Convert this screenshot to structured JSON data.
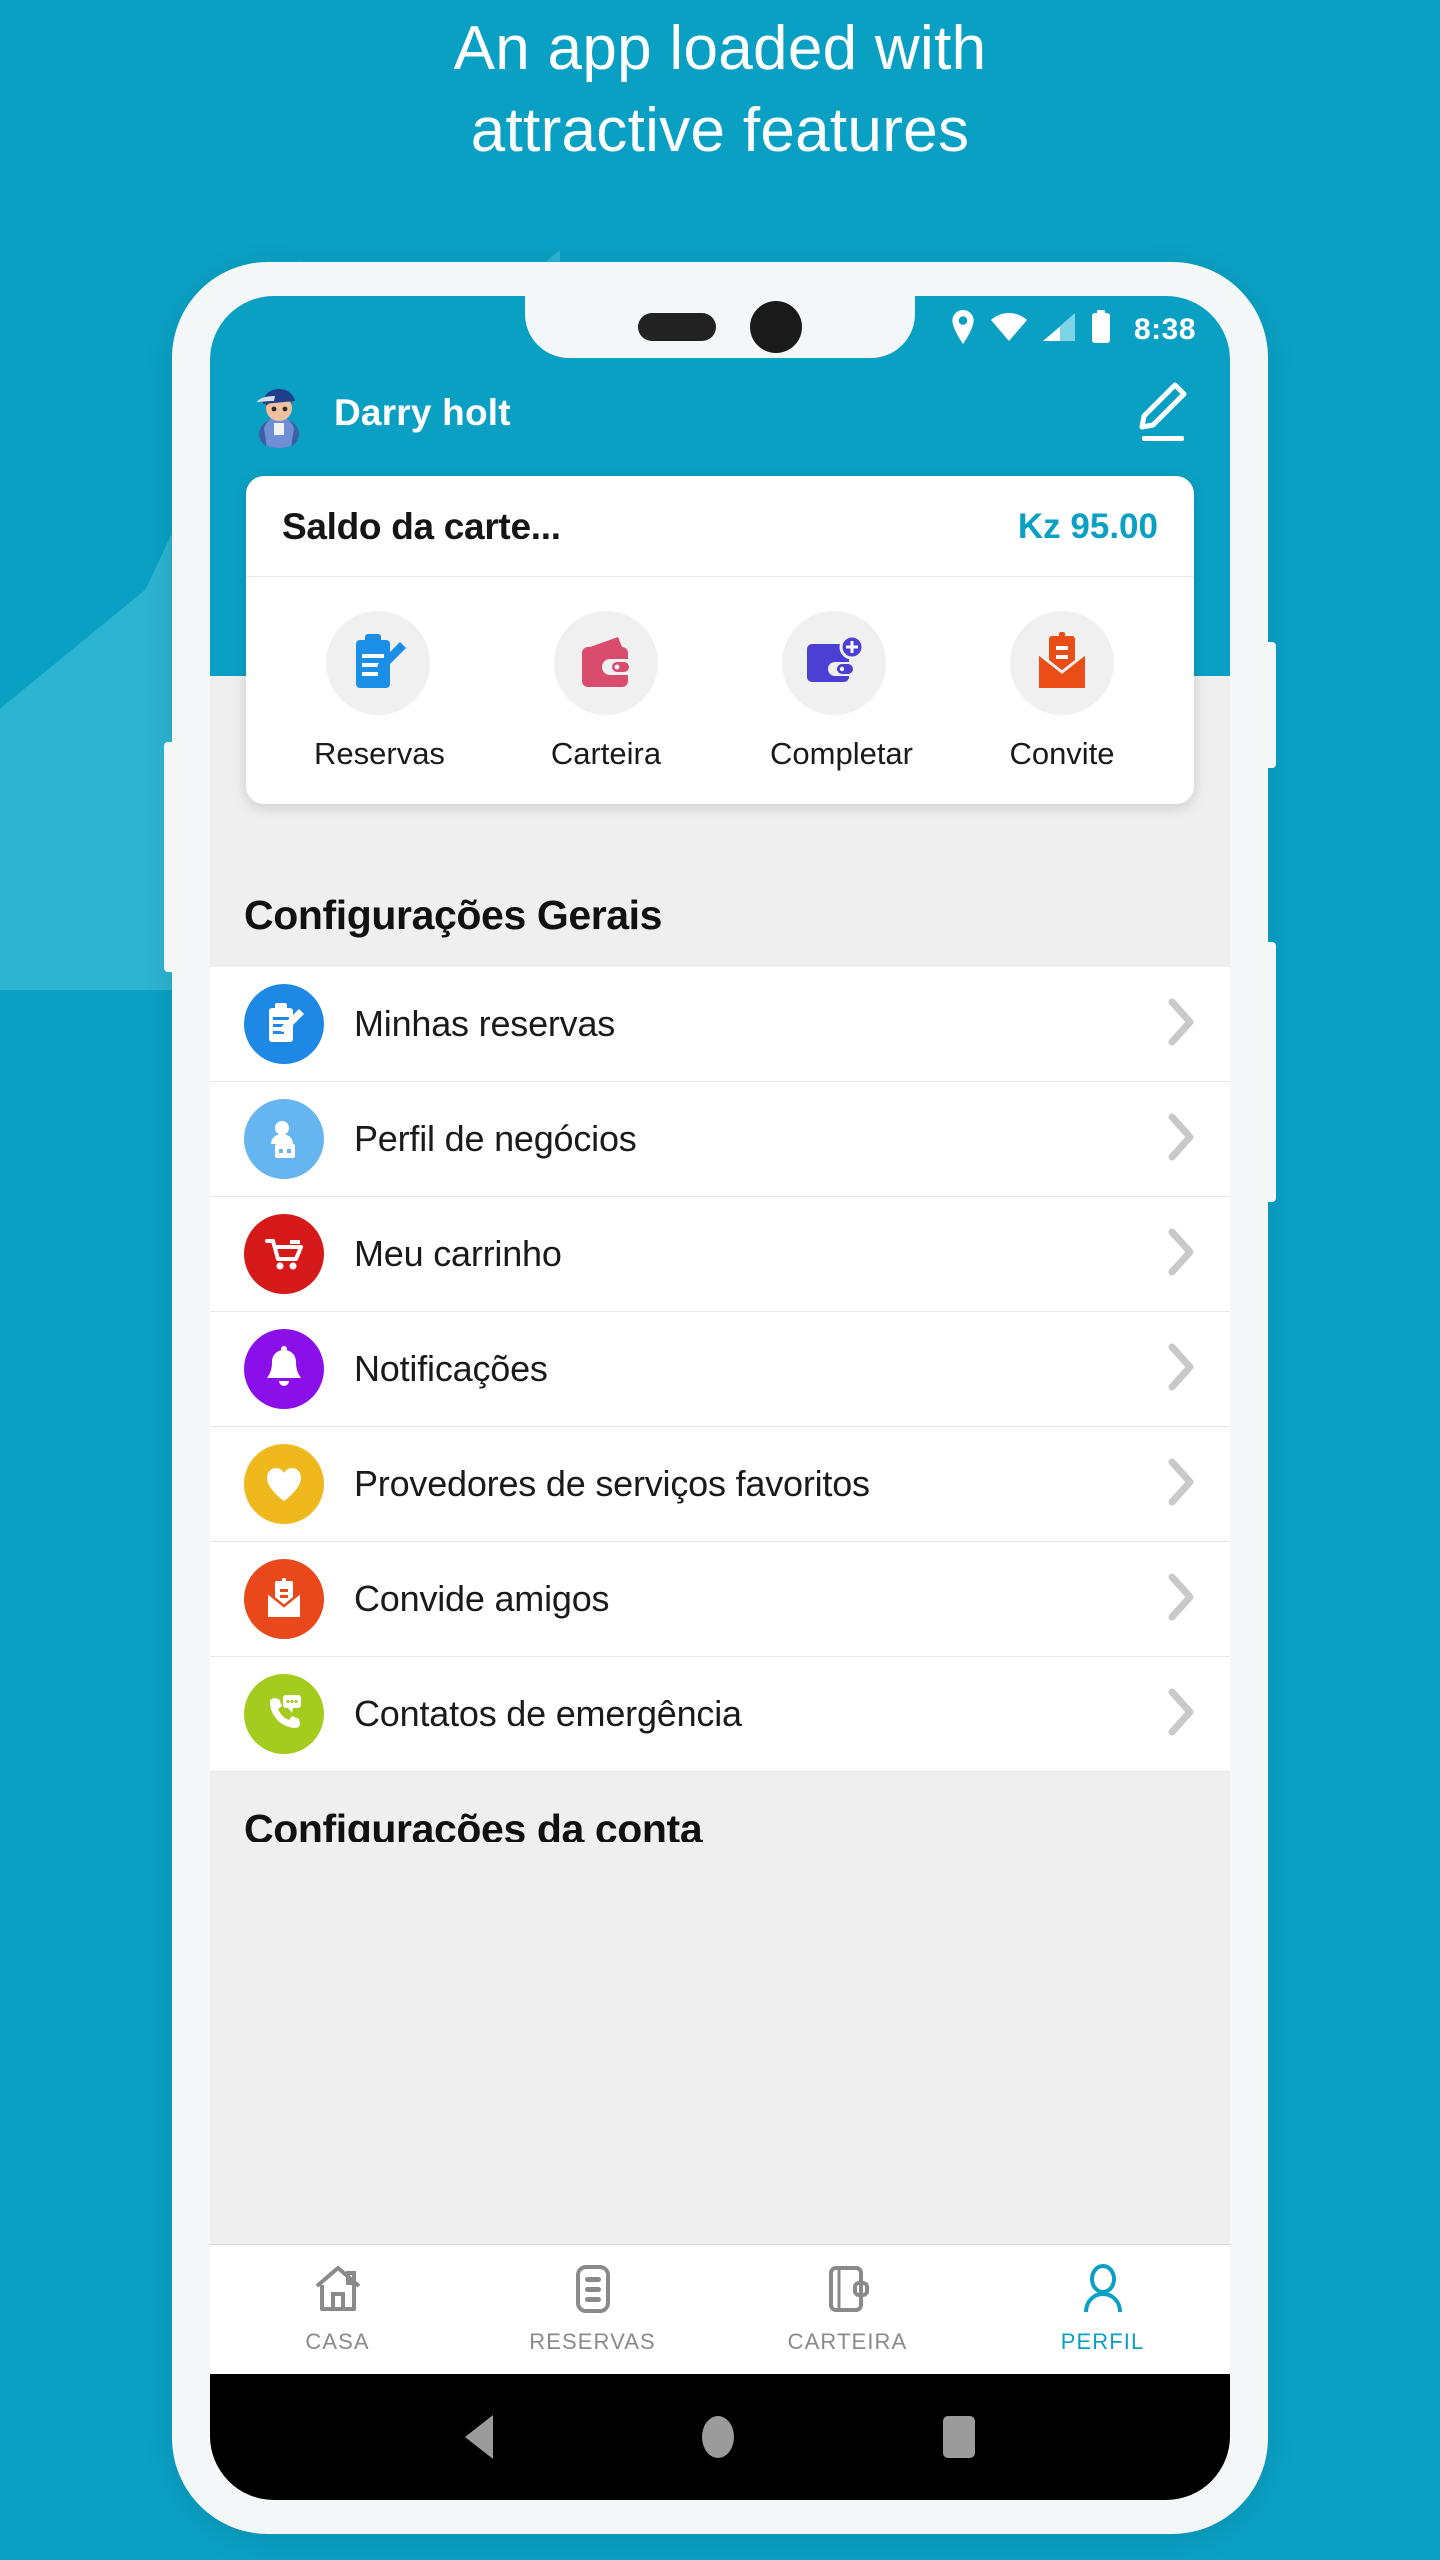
{
  "promo": {
    "headline_line1": "An app loaded with",
    "headline_line2": "attractive features",
    "bg_color": "#0AA0C4"
  },
  "status_bar": {
    "time": "8:38",
    "icons": [
      "location-icon",
      "wifi-icon",
      "signal-icon",
      "battery-icon"
    ]
  },
  "app_header": {
    "user_name": "Darry holt",
    "edit_icon": "pencil-icon",
    "avatar": "user-avatar"
  },
  "wallet_card": {
    "balance_label": "Saldo da carte...",
    "balance_amount": "Kz 95.00",
    "amount_color": "#0AA0C4",
    "quick_actions": [
      {
        "label": "Reservas",
        "icon": "clipboard-pencil-icon",
        "color": "#1B8FE8"
      },
      {
        "label": "Carteira",
        "icon": "wallet-icon",
        "color": "#D94C6E"
      },
      {
        "label": "Completar",
        "icon": "wallet-plus-icon",
        "color": "#4B3FD4"
      },
      {
        "label": "Convite",
        "icon": "invite-envelope-icon",
        "color": "#EA4E16"
      }
    ]
  },
  "settings": {
    "section_title": "Configurações Gerais",
    "next_section_title": "Configurações da conta",
    "items": [
      {
        "label": "Minhas reservas",
        "icon": "clipboard-pencil-icon",
        "color": "#1E88E5"
      },
      {
        "label": "Perfil de negócios",
        "icon": "business-profile-icon",
        "color": "#64B5F0"
      },
      {
        "label": "Meu carrinho",
        "icon": "shopping-cart-icon",
        "color": "#D61A1A"
      },
      {
        "label": "Notificações",
        "icon": "bell-icon",
        "color": "#8A0FE8"
      },
      {
        "label": "Provedores de serviços favoritos",
        "icon": "heart-icon",
        "color": "#EFB91E"
      },
      {
        "label": "Convide amigos",
        "icon": "invite-envelope-icon",
        "color": "#E8481A"
      },
      {
        "label": "Contatos de emergência",
        "icon": "emergency-call-icon",
        "color": "#A4CC1E"
      }
    ],
    "chevron_icon": "chevron-right-icon"
  },
  "tab_bar": {
    "active_color": "#0AA0C4",
    "inactive_color": "#8A8A8A",
    "tabs": [
      {
        "label": "CASA",
        "icon": "home-icon",
        "active": false
      },
      {
        "label": "RESERVAS",
        "icon": "list-icon",
        "active": false
      },
      {
        "label": "CARTEIRA",
        "icon": "wallet-icon",
        "active": false
      },
      {
        "label": "PERFIL",
        "icon": "person-icon",
        "active": true
      }
    ]
  },
  "android_nav": {
    "back": "back-triangle-icon",
    "home": "home-circle-icon",
    "recents": "recents-square-icon"
  }
}
